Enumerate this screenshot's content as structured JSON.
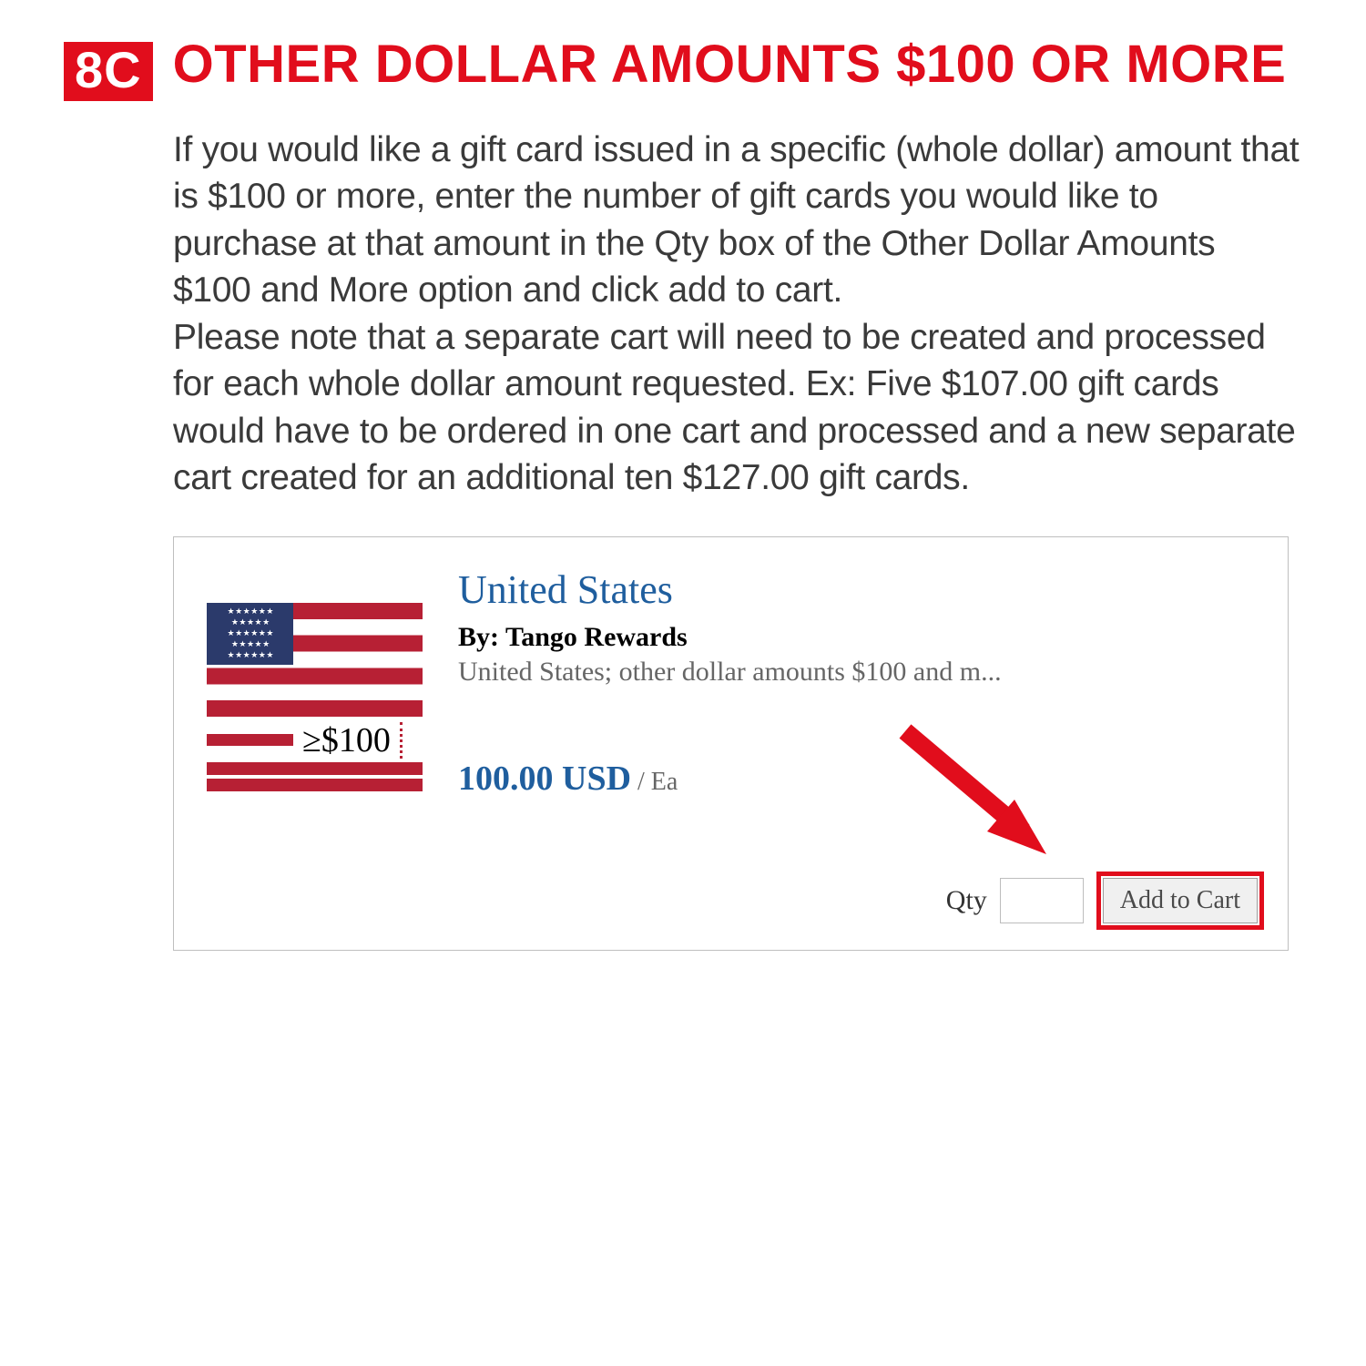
{
  "section": {
    "badge": "8C",
    "title": "OTHER DOLLAR AMOUNTS $100 OR MORE",
    "para1": "If you would like a gift card issued in a specific (whole dollar) amount that is $100 or more, enter the number of gift cards you would like to purchase at that amount in the Qty box of the Other Dollar Amounts $100 and More option and click add to cart.",
    "para2": "Please note that a separate cart will need to be created and processed for each whole dollar amount requested.  Ex: Five $107.00 gift cards would have to be ordered in one cart and processed and a new separate cart created for an additional ten $127.00 gift cards."
  },
  "product": {
    "title": "United States",
    "by": "By: Tango Rewards",
    "description": "United States; other dollar amounts $100 and m...",
    "price": "100.00 USD",
    "per": " / Ea",
    "ge_label": "≥$100",
    "qty_label": "Qty",
    "qty_value": "",
    "add_label": "Add to Cart"
  }
}
